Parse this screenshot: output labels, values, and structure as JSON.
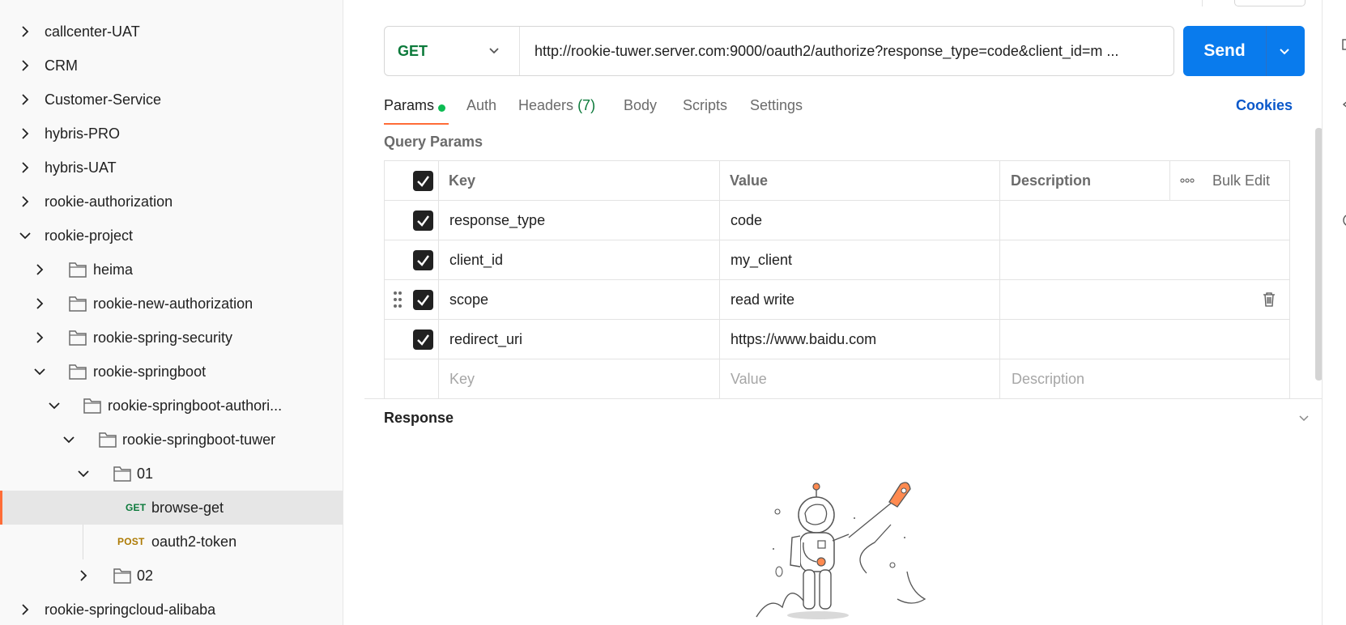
{
  "sidebar": {
    "items": [
      {
        "label": "callcenter-UAT",
        "expanded": false
      },
      {
        "label": "CRM",
        "expanded": false
      },
      {
        "label": "Customer-Service",
        "expanded": false
      },
      {
        "label": "hybris-PRO",
        "expanded": false
      },
      {
        "label": "hybris-UAT",
        "expanded": false
      },
      {
        "label": "rookie-authorization",
        "expanded": false
      },
      {
        "label": "rookie-project",
        "expanded": true
      },
      {
        "label": "heima",
        "expanded": false
      },
      {
        "label": "rookie-new-authorization",
        "expanded": false
      },
      {
        "label": "rookie-spring-security",
        "expanded": false
      },
      {
        "label": "rookie-springboot",
        "expanded": true
      },
      {
        "label": "rookie-springboot-authori...",
        "expanded": true
      },
      {
        "label": "rookie-springboot-tuwer",
        "expanded": true
      },
      {
        "label": "01",
        "expanded": true
      },
      {
        "label": "browse-get",
        "method": "GET",
        "selected": true
      },
      {
        "label": "oauth2-token",
        "method": "POST"
      },
      {
        "label": "02",
        "expanded": false
      },
      {
        "label": "rookie-springcloud-alibaba",
        "expanded": false
      }
    ]
  },
  "request": {
    "method": "GET",
    "url": "http://rookie-tuwer.server.com:9000/oauth2/authorize?response_type=code&client_id=m ...",
    "send_label": "Send"
  },
  "tabs": {
    "params": "Params",
    "auth": "Auth",
    "headers": "Headers",
    "headers_count": "(7)",
    "body": "Body",
    "scripts": "Scripts",
    "settings": "Settings",
    "cookies": "Cookies"
  },
  "query_params": {
    "title": "Query Params",
    "headers": {
      "key": "Key",
      "value": "Value",
      "description": "Description",
      "bulk_edit": "Bulk Edit"
    },
    "rows": [
      {
        "key": "response_type",
        "value": "code",
        "checked": true
      },
      {
        "key": "client_id",
        "value": "my_client",
        "checked": true
      },
      {
        "key": "scope",
        "value": "read write",
        "checked": true
      },
      {
        "key": "redirect_uri",
        "value": "https://www.baidu.com",
        "checked": true
      }
    ],
    "placeholders": {
      "key": "Key",
      "value": "Value",
      "description": "Description"
    }
  },
  "response": {
    "title": "Response"
  },
  "colors": {
    "accent": "#ff6c37",
    "send": "#097bed",
    "get": "#0c7a3b",
    "post": "#ad7a03",
    "link": "#0a58ca"
  }
}
